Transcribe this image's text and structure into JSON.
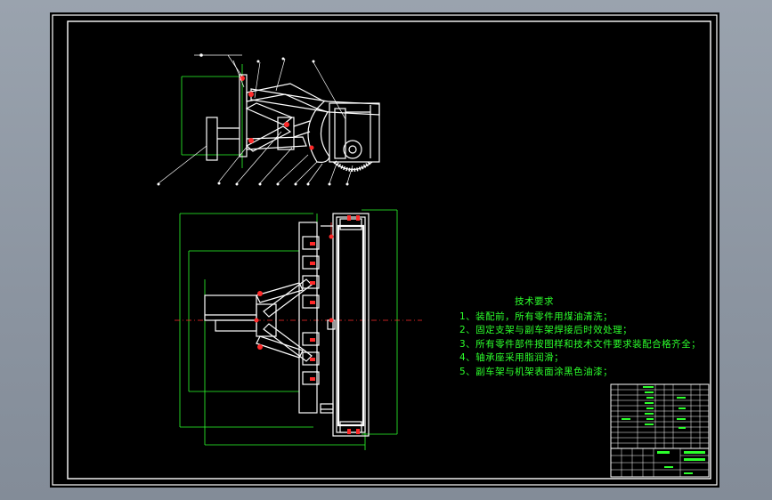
{
  "technical_requirements": {
    "title": "技术要求",
    "items": [
      "1、装配前，所有零件用煤油清洗；",
      "2、固定支架与副车架焊接后时效处理；",
      "3、所有零件部件按图样和技术文件要求装配合格齐全；",
      "4、轴承座采用脂润滑；",
      "5、副车架与机架表面涂黑色油漆；"
    ]
  },
  "colors": {
    "background": "#000000",
    "sheet_border": "#ffffff",
    "dimension": "#2cff2c",
    "center_line": "#ff2a2a",
    "part": "#ffffff",
    "leader": "#ffffff"
  }
}
